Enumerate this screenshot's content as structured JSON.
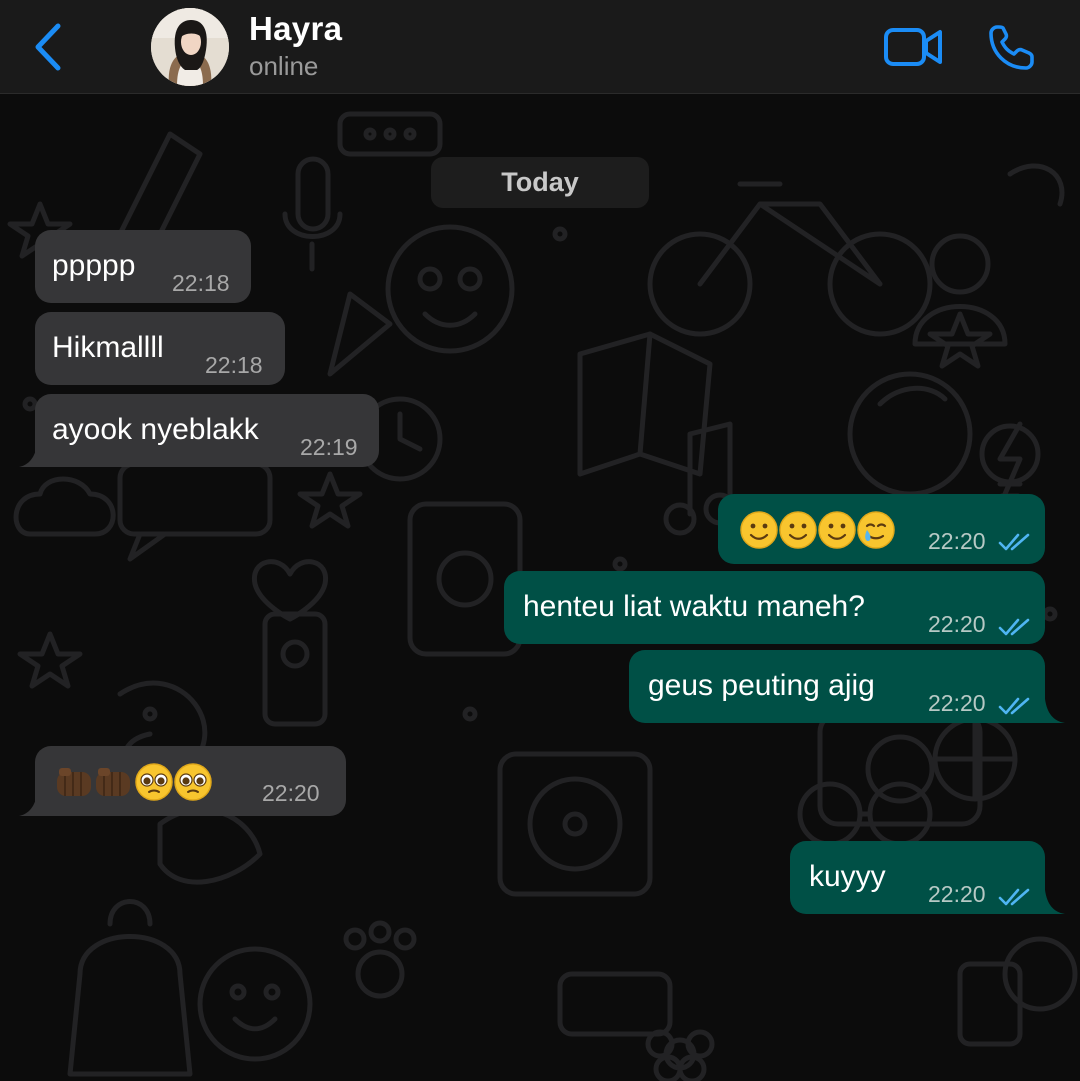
{
  "header": {
    "contact_name": "Hayra",
    "contact_status": "online",
    "icons": {
      "back": "chevron-left-icon",
      "video": "video-camera-icon",
      "phone": "phone-icon"
    },
    "accent_color": "#1b8cf5"
  },
  "chat": {
    "date_separator": "Today",
    "messages": [
      {
        "direction": "in",
        "text": "ppppp",
        "time": "22:18"
      },
      {
        "direction": "in",
        "text": "Hikmallll",
        "time": "22:18"
      },
      {
        "direction": "in",
        "text": "ayook nyeblakk",
        "time": "22:19"
      },
      {
        "direction": "out",
        "text": "🙂🙂🙂🥲",
        "time": "22:20",
        "read": true
      },
      {
        "direction": "out",
        "text": "henteu liat waktu maneh?",
        "time": "22:20",
        "read": true
      },
      {
        "direction": "out",
        "text": "geus peuting ajig",
        "time": "22:20",
        "read": true
      },
      {
        "direction": "in",
        "text": "👊🏿👊🏿🥹🥹",
        "time": "22:20"
      },
      {
        "direction": "out",
        "text": "kuyyy",
        "time": "22:20",
        "read": true
      }
    ],
    "colors": {
      "incoming_bubble": "#363638",
      "outgoing_bubble": "#005046",
      "read_tick": "#4fb5f2"
    }
  }
}
